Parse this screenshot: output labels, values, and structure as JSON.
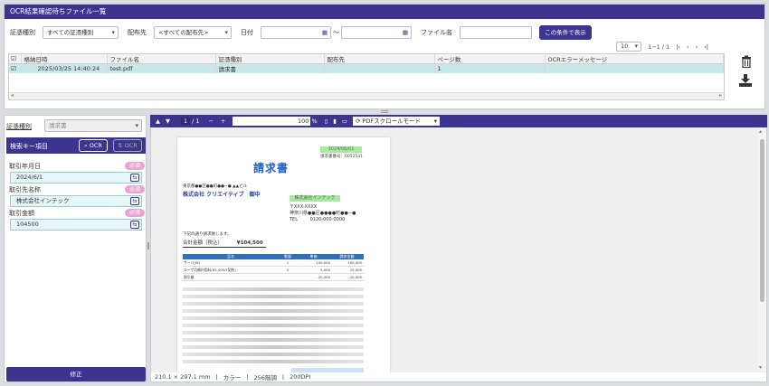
{
  "top": {
    "title": "OCR結果確認待ちファイル一覧",
    "filters": {
      "doc_type_label": "証憑種別",
      "doc_type_value": "すべての証憑種別",
      "recipient_label": "配布先",
      "recipient_value": "<すべての配布先>",
      "date_label": "日付",
      "tilde": "～",
      "filename_label": "ファイル名",
      "search_button": "この条件で表示"
    },
    "pager": {
      "page_size": "10",
      "range": "1−1 / 1",
      "first": "|‹",
      "prev": "‹",
      "next": "›",
      "last": "›|"
    },
    "columns": [
      "格納日時",
      "ファイル名",
      "証憑種別",
      "配布先",
      "ページ数",
      "OCRエラーメッセージ"
    ],
    "rows": [
      {
        "datetime": "2025/03/25 14:40:24",
        "filename": "test.pdf",
        "doc_type": "請求書",
        "recipient": "",
        "pages": "1",
        "error": ""
      }
    ]
  },
  "left": {
    "doc_type_label": "証憑種別",
    "doc_type_value": "請求書",
    "search_key_title": "検索キー項目",
    "ocr_button": "OCR",
    "ocr_button2": "OCR",
    "required_badge": "必須",
    "fields": [
      {
        "label": "取引年月日",
        "value": "2024/6/1"
      },
      {
        "label": "取引先名称",
        "value": "株式会社インテック"
      },
      {
        "label": "取引金額",
        "value": "104500"
      }
    ],
    "submit_button": "修正"
  },
  "viewer": {
    "page_current": "1",
    "page_total": "/ 1",
    "zoom": "100",
    "zoom_unit": "%",
    "scroll_mode": "PDFスクロールモード",
    "status": [
      "210.1 × 297.1 mm",
      "カラー",
      "256階調",
      "200DPI"
    ]
  },
  "document": {
    "date_line": "2024/06/01",
    "invoice_no": "請求書番号：0052531",
    "title": "請求書",
    "address_line": "東京都●●区●●町●●−● ▲▲ビル",
    "customer": "株式会社 クリエイティブ　御中",
    "issuer_highlight": "株式会社インテック",
    "postal": "〒XXX-XXXX",
    "issuer_address": "神奈川県●●区●●●●町●●−●",
    "tel_label": "TEL",
    "tel": "0120-000-0000",
    "intro": "下記の通り請求致します。",
    "total_label": "合計金額（税込）",
    "total_value": "¥104,500",
    "table_headers": [
      "品名",
      "数量",
      "単価",
      "請求金額"
    ],
    "table_rows": [
      [
        "サーバ(W)",
        "1",
        "100,000",
        "100,000"
      ],
      [
        "ユーザ月額利用料(¥5,000/1契約)",
        "5",
        "5,000",
        "25,000"
      ],
      [
        "割引額",
        "",
        "-20,000",
        "-20,000"
      ]
    ]
  }
}
